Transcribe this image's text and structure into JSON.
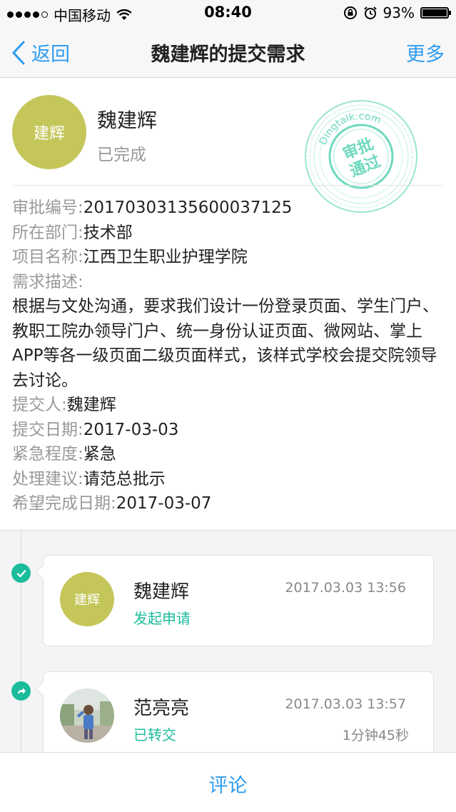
{
  "status_bar": {
    "carrier": "中国移动",
    "time": "08:40",
    "battery": "93%"
  },
  "nav": {
    "back_label": "返回",
    "title": "魏建辉的提交需求",
    "more_label": "更多"
  },
  "applicant": {
    "avatar_text": "建辉",
    "name": "魏建辉",
    "status": "已完成"
  },
  "stamp": {
    "brand": "Dingtalk.com",
    "line1": "审批",
    "line2": "通过",
    "color": "#6fd9bf"
  },
  "fields": {
    "approval_no_label": "审批编号:",
    "approval_no": "20170303135600037125",
    "dept_label": "所在部门:",
    "dept": "技术部",
    "project_label": "项目名称:",
    "project": "江西卫生职业护理学院",
    "desc_label": "需求描述:",
    "desc": "根据与文处沟通，要求我们设计一份登录页面、学生门户、教职工院办领导门户、统一身份认证页面、微网站、掌上APP等各一级页面二级页面样式，该样式学校会提交院领导去讨论。",
    "submitter_label": "提交人:",
    "submitter": "魏建辉",
    "submit_date_label": "提交日期:",
    "submit_date": "2017-03-03",
    "urgency_label": "紧急程度:",
    "urgency": "紧急",
    "suggestion_label": "处理建议:",
    "suggestion": "请范总批示",
    "due_date_label": "希望完成日期:",
    "due_date": "2017-03-07"
  },
  "timeline": [
    {
      "avatar_text": "建辉",
      "name": "魏建辉",
      "time": "2017.03.03 13:56",
      "action": "发起申请",
      "icon": "check-icon"
    },
    {
      "name": "范亮亮",
      "time": "2017.03.03 13:57",
      "action": "已转交",
      "duration": "1分钟45秒",
      "icon": "forward-icon"
    }
  ],
  "bottom": {
    "comment_label": "评论"
  },
  "colors": {
    "accent": "#2d9cf0",
    "success": "#1abc9c",
    "avatar": "#c5c65a"
  }
}
